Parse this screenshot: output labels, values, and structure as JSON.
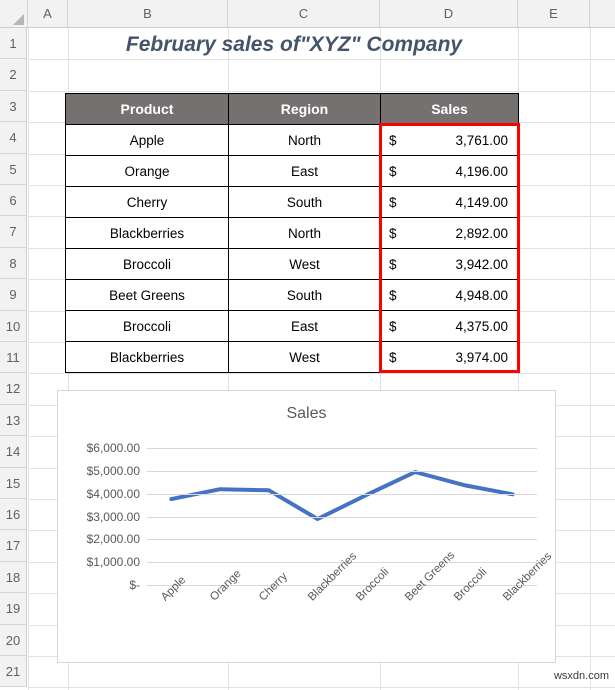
{
  "spreadsheet": {
    "column_headers": [
      "A",
      "B",
      "C",
      "D",
      "E"
    ],
    "row_headers": [
      "1",
      "2",
      "3",
      "4",
      "5",
      "6",
      "7",
      "8",
      "9",
      "10",
      "11",
      "12",
      "13",
      "14",
      "15",
      "16",
      "17",
      "18",
      "19",
      "20",
      "21"
    ],
    "title": "February sales of\"XYZ\" Company",
    "title_color": "#44546A",
    "watermark": "wsxdn.com"
  },
  "table": {
    "header_bg": "#757171",
    "header_text_color": "#FFFFFF",
    "highlight_color": "#FF0000",
    "columns": [
      "Product",
      "Region",
      "Sales"
    ],
    "rows": [
      {
        "product": "Apple",
        "region": "North",
        "currency": "$",
        "sales": "3,761.00",
        "value": 3761
      },
      {
        "product": "Orange",
        "region": "East",
        "currency": "$",
        "sales": "4,196.00",
        "value": 4196
      },
      {
        "product": "Cherry",
        "region": "South",
        "currency": "$",
        "sales": "4,149.00",
        "value": 4149
      },
      {
        "product": "Blackberries",
        "region": "North",
        "currency": "$",
        "sales": "2,892.00",
        "value": 2892
      },
      {
        "product": "Broccoli",
        "region": "West",
        "currency": "$",
        "sales": "3,942.00",
        "value": 3942
      },
      {
        "product": "Beet Greens",
        "region": "South",
        "currency": "$",
        "sales": "4,948.00",
        "value": 4948
      },
      {
        "product": "Broccoli",
        "region": "East",
        "currency": "$",
        "sales": "4,375.00",
        "value": 4375
      },
      {
        "product": "Blackberries",
        "region": "West",
        "currency": "$",
        "sales": "3,974.00",
        "value": 3974
      }
    ]
  },
  "chart_data": {
    "type": "line",
    "title": "Sales",
    "xlabel": "",
    "ylabel": "",
    "categories": [
      "Apple",
      "Orange",
      "Cherry",
      "Blackberries",
      "Broccoli",
      "Beet Greens",
      "Broccoli",
      "Blackberries"
    ],
    "series": [
      {
        "name": "Sales",
        "values": [
          3761,
          4196,
          4149,
          2892,
          3942,
          4948,
          4375,
          3974
        ],
        "color": "#4472C4"
      }
    ],
    "ylim": [
      0,
      6000
    ],
    "ytick_values": [
      0,
      1000,
      2000,
      3000,
      4000,
      5000,
      6000
    ],
    "ytick_labels": [
      "$-",
      "$1,000.00",
      "$2,000.00",
      "$3,000.00",
      "$4,000.00",
      "$5,000.00",
      "$6,000.00"
    ],
    "grid": true,
    "legend": "none",
    "line_color": "#4472C4",
    "gridline_color": "#D9D9D9",
    "axis_text_color": "#595959"
  }
}
